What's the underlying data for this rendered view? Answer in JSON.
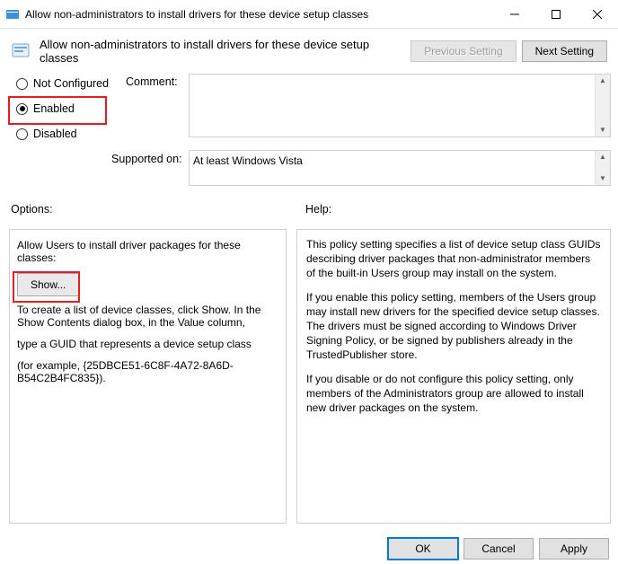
{
  "window": {
    "title": "Allow non-administrators to install drivers for these device setup classes"
  },
  "header": {
    "title": "Allow non-administrators to install drivers for these device setup classes",
    "prev": "Previous Setting",
    "next": "Next Setting"
  },
  "radios": {
    "not_configured": "Not Configured",
    "enabled": "Enabled",
    "disabled": "Disabled",
    "selected": "enabled"
  },
  "labels": {
    "comment": "Comment:",
    "supported": "Supported on:",
    "options": "Options:",
    "help": "Help:"
  },
  "supported_text": "At least Windows Vista",
  "options": {
    "intro": "Allow Users to install driver packages for these classes:",
    "show": "Show...",
    "line1": "To create a list of device classes, click Show. In the Show Contents dialog box, in the Value column,",
    "line2": "type a GUID that represents a device setup class",
    "line3": "(for example, {25DBCE51-6C8F-4A72-8A6D-B54C2B4FC835})."
  },
  "help": {
    "p1": "This policy setting specifies a list of device setup class GUIDs describing driver packages that non-administrator members of the built-in Users group may install on the system.",
    "p2": "If you enable this policy setting, members of the Users group may install new drivers for the specified device setup classes. The drivers must be signed according to Windows Driver Signing Policy, or be signed by publishers already in the TrustedPublisher store.",
    "p3": "If you disable or do not configure this policy setting, only members of the Administrators group are allowed to install new driver packages on the system."
  },
  "footer": {
    "ok": "OK",
    "cancel": "Cancel",
    "apply": "Apply"
  }
}
